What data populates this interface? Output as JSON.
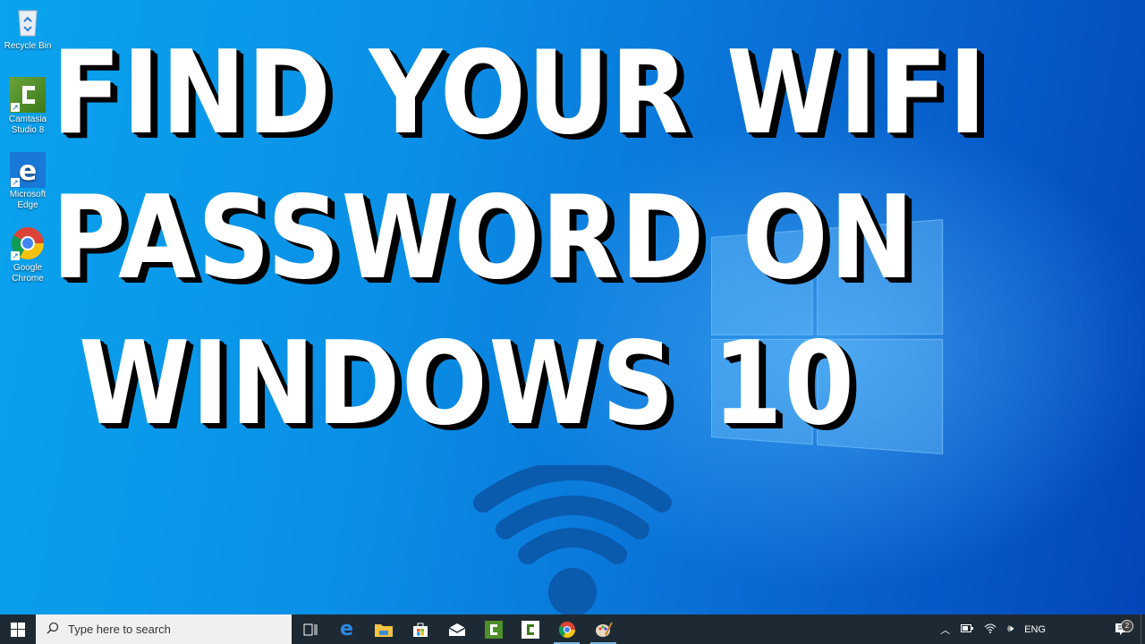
{
  "desktop": {
    "icons": [
      {
        "label": "Recycle Bin",
        "icon": "recycle-bin-icon"
      },
      {
        "label": "Camtasia Studio 8",
        "icon": "camtasia-icon",
        "shortcut": true
      },
      {
        "label": "Microsoft Edge",
        "icon": "edge-icon",
        "shortcut": true
      },
      {
        "label": "Google Chrome",
        "icon": "chrome-icon",
        "shortcut": true
      }
    ]
  },
  "overlay": {
    "lines": [
      "FIND YOUR WIFI",
      "PASSWORD ON",
      "WINDOWS 10"
    ],
    "graphic": "wifi-icon"
  },
  "taskbar": {
    "search_placeholder": "Type here to search",
    "pinned": [
      {
        "name": "task-view",
        "icon": "task-view-icon",
        "running": false
      },
      {
        "name": "edge",
        "icon": "edge-icon",
        "running": false
      },
      {
        "name": "file-explorer",
        "icon": "folder-icon",
        "running": false
      },
      {
        "name": "store",
        "icon": "store-icon",
        "running": false
      },
      {
        "name": "mail",
        "icon": "mail-icon",
        "running": false
      },
      {
        "name": "camtasia-studio",
        "icon": "camtasia-icon",
        "running": false
      },
      {
        "name": "camtasia-recorder",
        "icon": "camtasia-recorder-icon",
        "running": false
      },
      {
        "name": "chrome",
        "icon": "chrome-icon",
        "running": true
      },
      {
        "name": "paint",
        "icon": "paint-icon",
        "running": true
      }
    ],
    "tray": {
      "language": "ENG",
      "notification_count": "2"
    }
  },
  "colors": {
    "taskbar": "#1e2a33",
    "wifi_symbol": "#0a5aae",
    "title_fill": "#ffffff",
    "title_shadow": "#000000"
  }
}
